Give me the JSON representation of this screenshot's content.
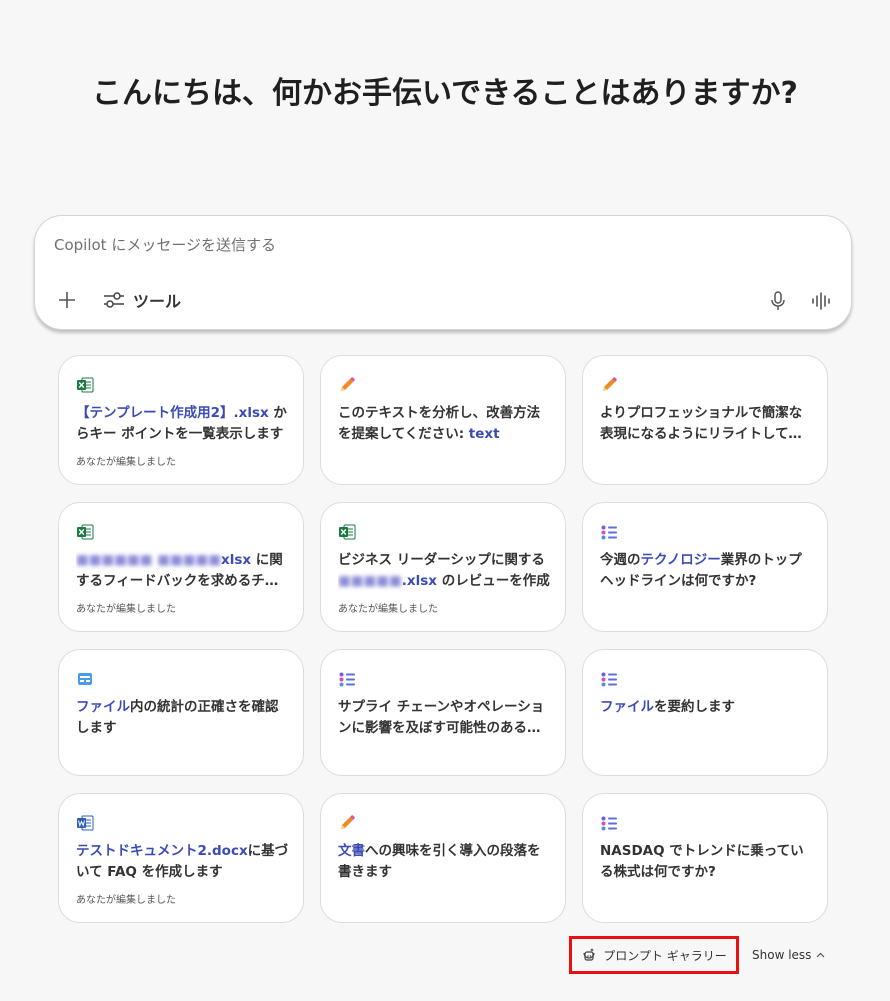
{
  "greeting": "こんにちは、何かお手伝いできることはありますか?",
  "composer": {
    "placeholder": "Copilot にメッセージを送信する",
    "tools_label": "ツール"
  },
  "cards": [
    {
      "icon": "excel-icon",
      "parts": [
        {
          "t": "【テンプレート作成用2】.xlsx",
          "s": "hl"
        },
        {
          "t": " からキー ポイントを一覧表示します"
        }
      ],
      "meta": "あなたが編集しました"
    },
    {
      "icon": "pencil-icon",
      "parts": [
        {
          "t": "このテキストを分析し、改善方法を提案してください: "
        },
        {
          "t": "text",
          "s": "hl"
        }
      ],
      "meta": ""
    },
    {
      "icon": "pencil-icon",
      "parts": [
        {
          "t": "よりプロフェッショナルで簡潔な表現になるようにリライトしてください"
        }
      ],
      "meta": ""
    },
    {
      "icon": "excel-icon",
      "parts": [
        {
          "t": "■■■■■■ ■■■■■",
          "s": "blur"
        },
        {
          "t": "xlsx",
          "s": "hl"
        },
        {
          "t": " に関するフィードバックを求めるチーム宛てのメール"
        }
      ],
      "meta": "あなたが編集しました"
    },
    {
      "icon": "excel-icon",
      "parts": [
        {
          "t": "ビジネス リーダーシップに関する "
        },
        {
          "t": "■■■■■",
          "s": "blur"
        },
        {
          "t": ".xlsx",
          "s": "hl"
        },
        {
          "t": " のレビューを作成"
        }
      ],
      "meta": "あなたが編集しました"
    },
    {
      "icon": "list-icon",
      "parts": [
        {
          "t": "今週の"
        },
        {
          "t": "テクノロジー",
          "s": "hl"
        },
        {
          "t": "業界のトップ ヘッドラインは何ですか?"
        }
      ],
      "meta": ""
    },
    {
      "icon": "table-icon",
      "parts": [
        {
          "t": "ファイル",
          "s": "hl"
        },
        {
          "t": "内の統計の正確さを確認します"
        }
      ],
      "meta": ""
    },
    {
      "icon": "list-icon",
      "parts": [
        {
          "t": "サプライ チェーンやオペレーションに影響を及ぼす可能性のあるリスク"
        }
      ],
      "meta": ""
    },
    {
      "icon": "list-icon",
      "parts": [
        {
          "t": "ファイル",
          "s": "hl"
        },
        {
          "t": "を要約します"
        }
      ],
      "meta": ""
    },
    {
      "icon": "word-icon",
      "parts": [
        {
          "t": "テストドキュメント2.docx",
          "s": "hl"
        },
        {
          "t": "に基づいて FAQ を作成します"
        }
      ],
      "meta": "あなたが編集しました"
    },
    {
      "icon": "pencil-icon",
      "parts": [
        {
          "t": "文書",
          "s": "hl"
        },
        {
          "t": "への興味を引く導入の段落を書きます"
        }
      ],
      "meta": ""
    },
    {
      "icon": "list-icon",
      "parts": [
        {
          "t": "NASDAQ でトレンドに乗っている株式は何ですか?"
        }
      ],
      "meta": ""
    }
  ],
  "footer": {
    "gallery_label": "プロンプト ギャラリー",
    "show_less_label": "Show less"
  },
  "colors": {
    "highlight": "#3a4bb8",
    "gallery_border": "#e81010",
    "excel": "#1d7a45",
    "word": "#2b5fb4",
    "pencil": "#f08a24"
  }
}
